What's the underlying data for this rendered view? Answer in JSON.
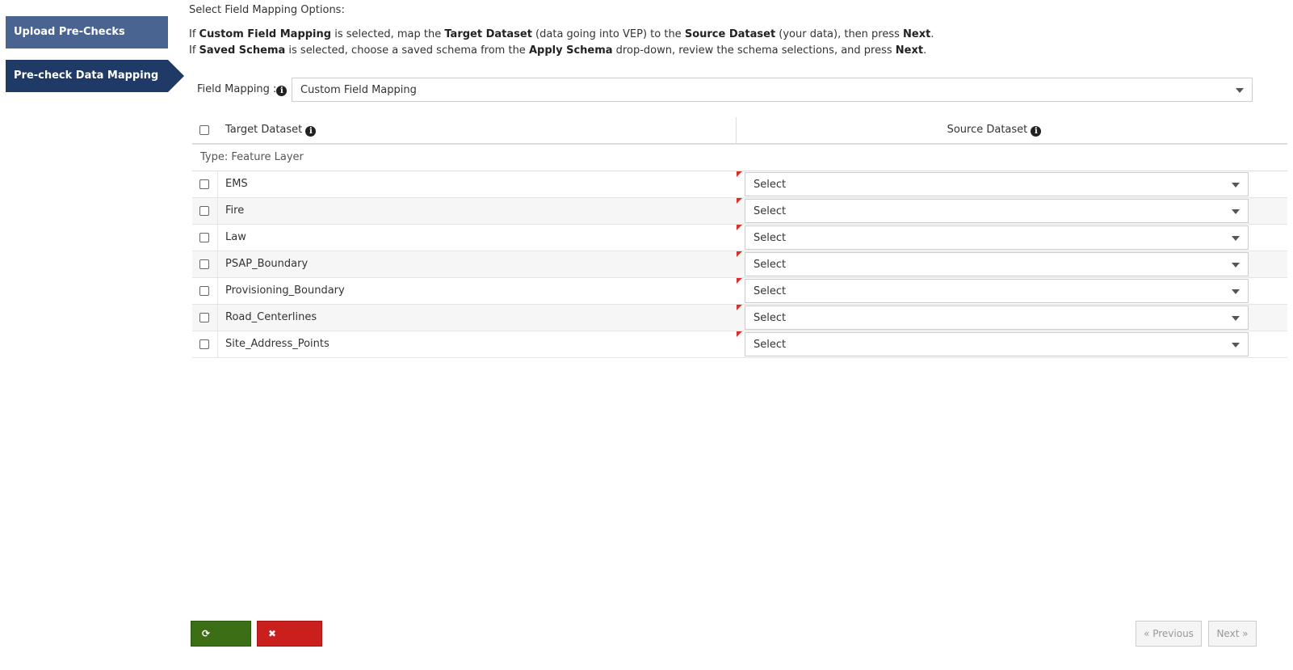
{
  "steps": [
    {
      "label": "Upload Pre-Checks",
      "active": false
    },
    {
      "label": "Pre-check Data Mapping",
      "active": true
    }
  ],
  "heading": "Select Field Mapping Options:",
  "instructions": {
    "line1": {
      "p1": "If ",
      "b1": "Custom Field Mapping",
      "p2": " is selected, map the ",
      "b2": "Target Dataset",
      "p3": " (data going into VEP) to the ",
      "b3": "Source Dataset",
      "p4": " (your data), then press ",
      "b4": "Next",
      "p5": "."
    },
    "line2": {
      "p1": "If ",
      "b1": "Saved Schema",
      "p2": " is selected, choose a saved schema from the ",
      "b2": "Apply Schema",
      "p3": " drop-down, review the schema selections, and press ",
      "b3": "Next",
      "p4": "."
    }
  },
  "field_mapping": {
    "label": "Field Mapping :",
    "value": "Custom Field Mapping"
  },
  "table": {
    "header_target": "Target Dataset",
    "header_source": "Source Dataset",
    "group_label": "Type: Feature Layer",
    "rows": [
      {
        "name": "EMS",
        "source": "Select"
      },
      {
        "name": "Fire",
        "source": "Select"
      },
      {
        "name": "Law",
        "source": "Select"
      },
      {
        "name": "PSAP_Boundary",
        "source": "Select"
      },
      {
        "name": "Provisioning_Boundary",
        "source": "Select"
      },
      {
        "name": "Road_Centerlines",
        "source": "Select"
      },
      {
        "name": "Site_Address_Points",
        "source": "Select"
      }
    ]
  },
  "footer": {
    "reset_label": "Reset",
    "cancel_label": "Cancel",
    "prev_label": "« Previous",
    "next_label": "Next »"
  },
  "icons": {
    "info": "info-icon",
    "reset": "refresh-icon",
    "cancel": "close-icon",
    "dropdown": "chevron-down-icon"
  },
  "colors": {
    "step_inactive": "#4a6491",
    "step_active": "#1f3a66",
    "reset_button": "#3c6e16",
    "cancel_button": "#c9201e",
    "required_flag": "#d9302b"
  }
}
